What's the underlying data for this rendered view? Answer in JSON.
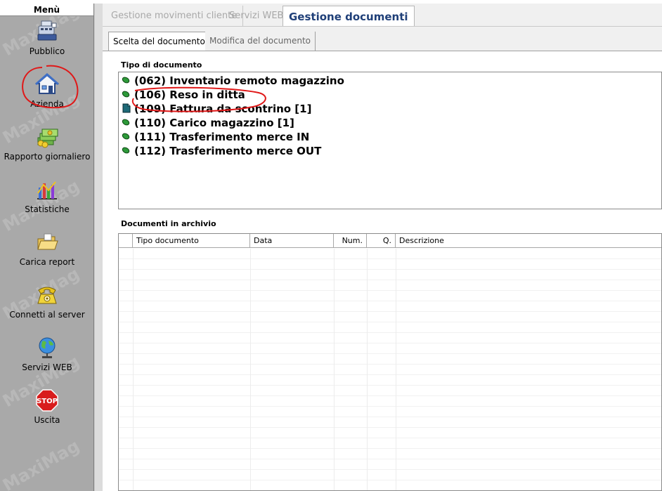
{
  "sidebar": {
    "header": "Menù",
    "watermark": "MaxiMag",
    "items": [
      {
        "label": "Pubblico",
        "icon": "cash-register-icon"
      },
      {
        "label": "Azienda",
        "icon": "home-icon"
      },
      {
        "label": "Rapporto giornaliero",
        "icon": "money-stack-icon"
      },
      {
        "label": "Statistiche",
        "icon": "bar-chart-icon"
      },
      {
        "label": "Carica report",
        "icon": "open-folder-icon"
      },
      {
        "label": "Connetti al server",
        "icon": "telephone-icon"
      },
      {
        "label": "Servizi WEB",
        "icon": "globe-icon"
      },
      {
        "label": "Uscita",
        "icon": "stop-sign-icon"
      }
    ],
    "stop_text": "STOP"
  },
  "top_tabs": [
    {
      "label": "Gestione movimenti cliente",
      "active": false
    },
    {
      "label": "Servizi WEB",
      "active": false
    },
    {
      "label": "Gestione documenti",
      "active": true
    }
  ],
  "sub_tabs": [
    {
      "label": "Scelta del documento",
      "active": true
    },
    {
      "label": "Modifica del documento",
      "active": false
    }
  ],
  "document_types": {
    "label": "Tipo di documento",
    "items": [
      {
        "text": "(062) Inventario remoto magazzino",
        "icon": "green-bullet-icon"
      },
      {
        "text": "(106) Reso in ditta",
        "icon": "green-bullet-icon"
      },
      {
        "text": "(109) Fattura da scontrino [1]",
        "icon": "document-icon"
      },
      {
        "text": "(110) Carico magazzino [1]",
        "icon": "green-bullet-icon"
      },
      {
        "text": "(111) Trasferimento merce IN",
        "icon": "green-bullet-icon"
      },
      {
        "text": "(112) Trasferimento merce OUT",
        "icon": "green-bullet-icon"
      }
    ]
  },
  "archive": {
    "label": "Documenti in archivio",
    "columns": [
      "",
      "Tipo documento",
      "Data",
      "Num.",
      "Q.",
      "Descrizione"
    ],
    "rows": []
  },
  "colors": {
    "sidebar_bg": "#a9a9a9",
    "active_tab_text": "#1f3f78",
    "annotation_red": "#e01818",
    "bullet_green": "#2e9a3a"
  }
}
